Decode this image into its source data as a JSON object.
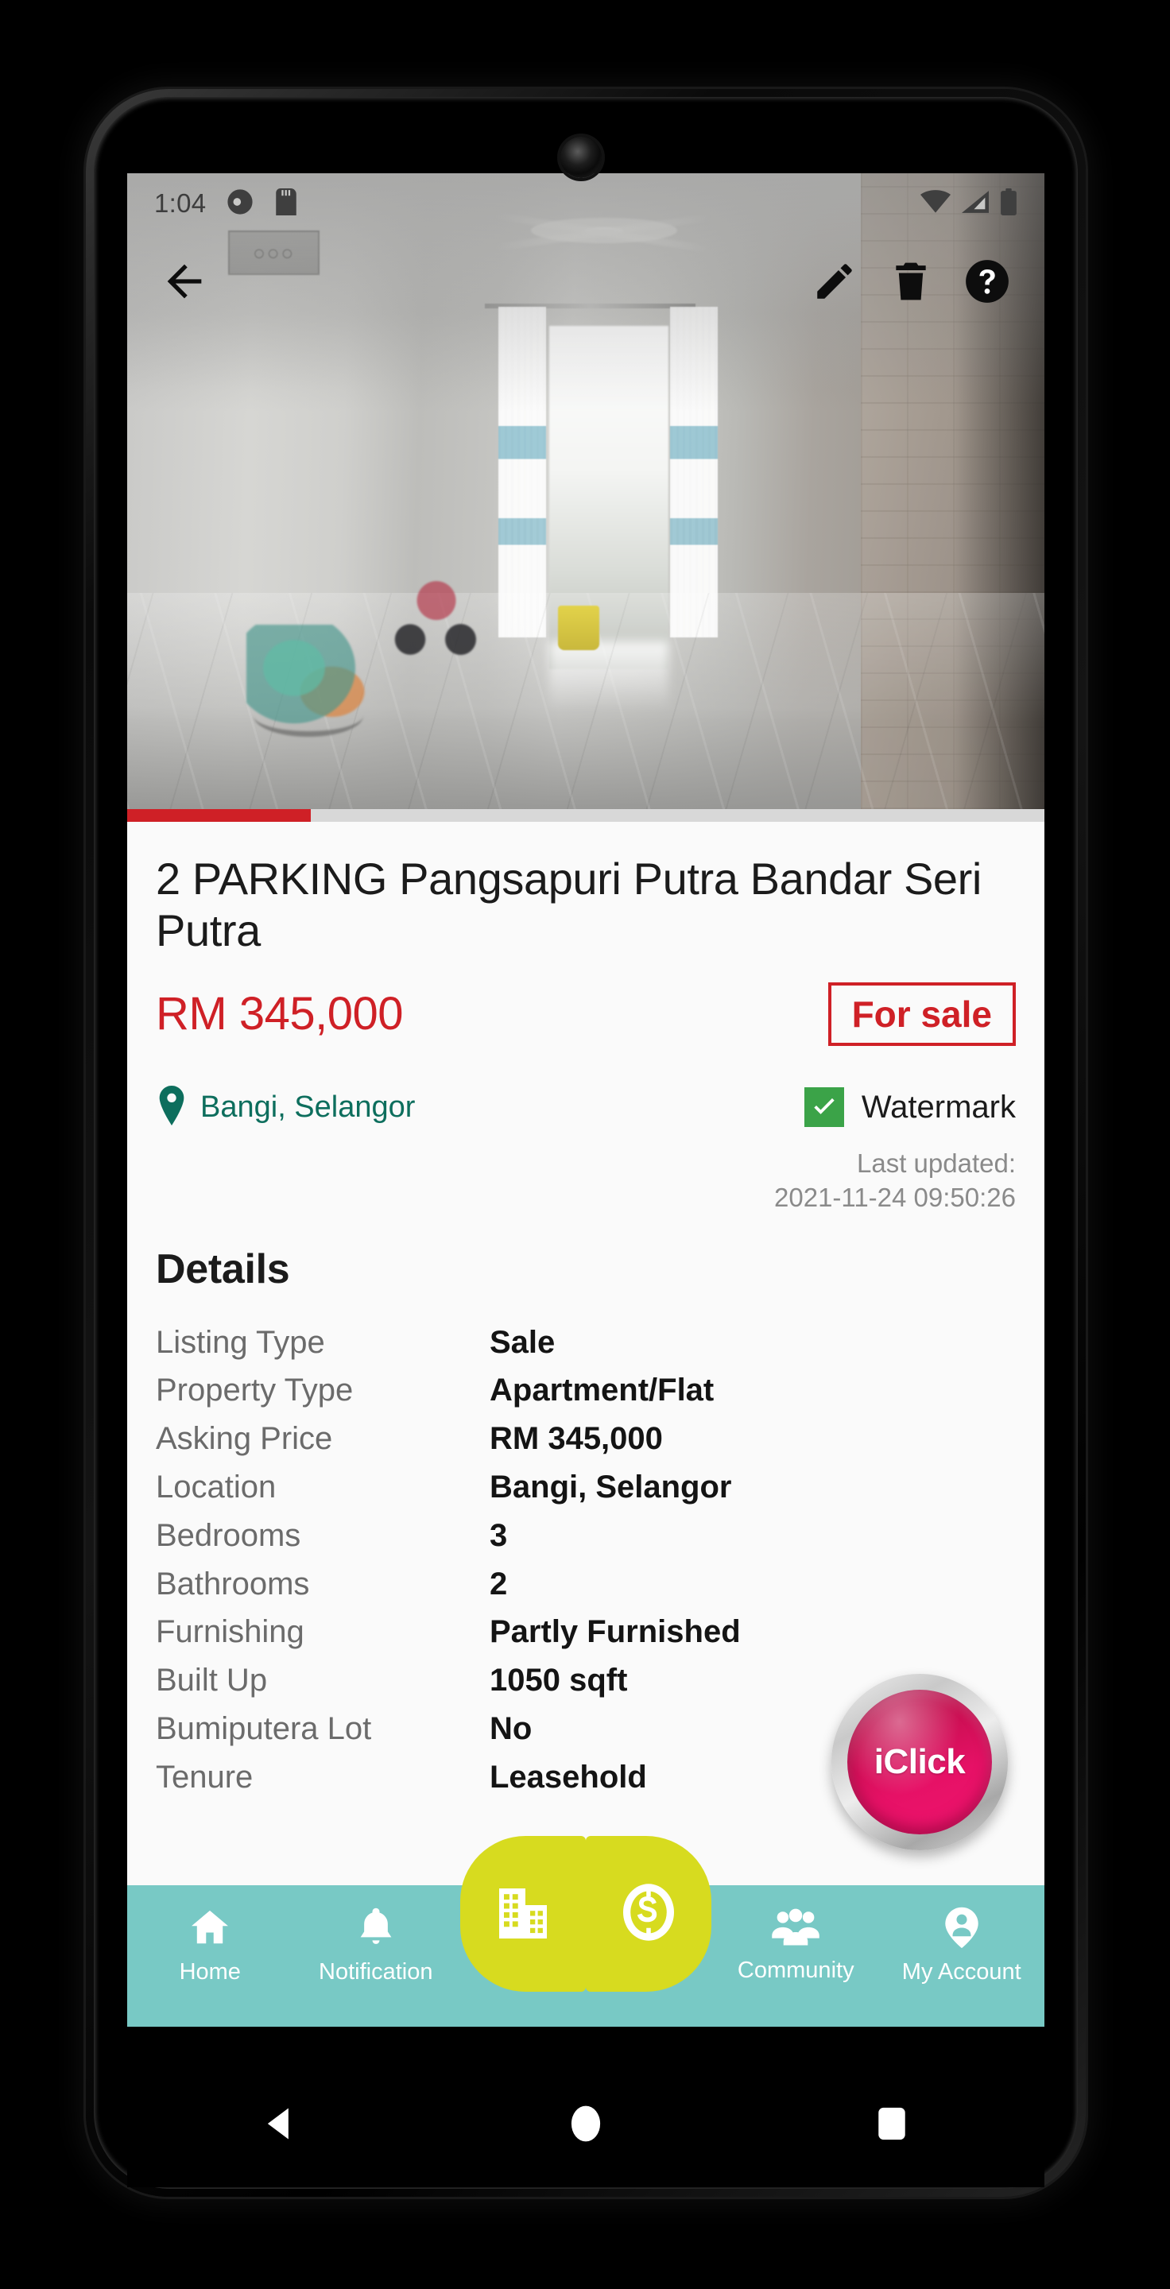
{
  "status_bar": {
    "time": "1:04",
    "left_icons": [
      "do-not-disturb-icon",
      "sd-card-icon"
    ],
    "right_icons": [
      "wifi-icon",
      "cellular-signal-icon",
      "battery-icon"
    ]
  },
  "toolbar": {
    "back_label": "Back",
    "edit_label": "Edit",
    "delete_label": "Delete",
    "help_label": "Help",
    "icons": [
      "arrow-back-icon",
      "pencil-edit-icon",
      "trash-delete-icon",
      "help-circle-icon"
    ]
  },
  "gallery": {
    "photo_count": "5",
    "progress_percent": 20,
    "progress_color": "#cf2026"
  },
  "listing": {
    "title": "2 PARKING Pangsapuri Putra Bandar Seri Putra",
    "price": "RM 345,000",
    "status_badge": "For sale",
    "location": "Bangi, Selangor",
    "watermark_label": "Watermark",
    "watermark_checked": true,
    "last_updated_label": "Last updated:",
    "last_updated_value": "2021-11-24 09:50:26",
    "accent_red": "#cf2026",
    "location_green": "#0d6e5d",
    "check_green": "#3ba348"
  },
  "details": {
    "heading": "Details",
    "rows": [
      {
        "label": "Listing Type",
        "value": "Sale"
      },
      {
        "label": "Property Type",
        "value": "Apartment/Flat"
      },
      {
        "label": "Asking Price",
        "value": "RM 345,000"
      },
      {
        "label": "Location",
        "value": "Bangi, Selangor"
      },
      {
        "label": "Bedrooms",
        "value": "3"
      },
      {
        "label": "Bathrooms",
        "value": "2"
      },
      {
        "label": "Furnishing",
        "value": "Partly Furnished"
      },
      {
        "label": "Built Up",
        "value": "1050 sqft"
      },
      {
        "label": "Bumiputera Lot",
        "value": "No"
      },
      {
        "label": "Tenure",
        "value": "Leasehold"
      }
    ]
  },
  "fab": {
    "label": "iClick",
    "color": "#e61166"
  },
  "bottom_nav": {
    "background": "#78c9c5",
    "center_color": "#d7db1f",
    "items": [
      {
        "label": "Home",
        "icon": "home-icon"
      },
      {
        "label": "Notification",
        "icon": "bell-icon"
      },
      {
        "label": "Community",
        "icon": "people-group-icon"
      },
      {
        "label": "My Account",
        "icon": "account-person-icon"
      }
    ],
    "center_buttons": [
      {
        "icon": "building-icon",
        "label": "Property"
      },
      {
        "icon": "dollar-coin-icon",
        "label": "Finance"
      }
    ]
  },
  "android_nav": {
    "back": "back-triangle-icon",
    "home": "home-circle-icon",
    "recents": "recents-square-icon"
  }
}
